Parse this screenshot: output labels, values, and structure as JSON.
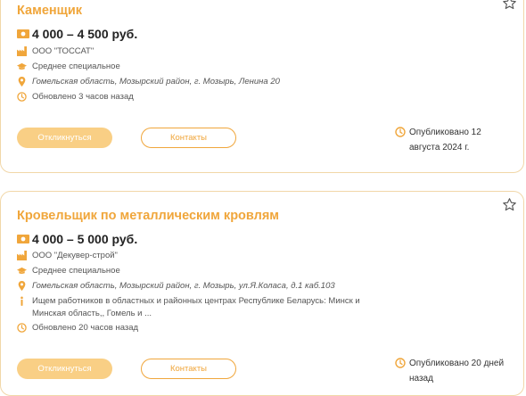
{
  "vacancies": [
    {
      "title": "Каменщик",
      "salary": "4 000 – 4 500 руб.",
      "company": "ООО \"ТОССАТ\"",
      "education": "Среднее специальное",
      "address": "Гомельская область, Мозырский район, г. Мозырь, Ленина 20",
      "updated": "Обновлено 3 часов назад",
      "respond_label": "Откликнуться",
      "contacts_label": "Контакты",
      "published": "Опубликовано 12 августа 2024 г."
    },
    {
      "title": "Кровельщик по металлическим кровлям",
      "salary": "4 000 – 5 000 руб.",
      "company": "ООО \"Декувер-строй\"",
      "education": "Среднее специальное",
      "address": "Гомельская область, Мозырский район, г. Мозырь, ул.Я.Коласа, д.1 каб.103",
      "info": "Ищем работников в областных и районных центрах Республике Беларусь: Минск и Минская область,, Гомель и ...",
      "updated": "Обновлено 20 часов назад",
      "respond_label": "Откликнуться",
      "contacts_label": "Контакты",
      "published": "Опубликовано 20 дней назад"
    }
  ],
  "icons": {
    "salary": "money-icon",
    "company": "factory-icon",
    "education": "graduation-cap-icon",
    "address": "map-pin-icon",
    "info": "info-icon",
    "updated": "clock-icon",
    "favorite": "star-icon"
  },
  "colors": {
    "accent": "#f0a63b",
    "button_fill": "#f9cf85",
    "card_border": "#f1d7a8"
  }
}
